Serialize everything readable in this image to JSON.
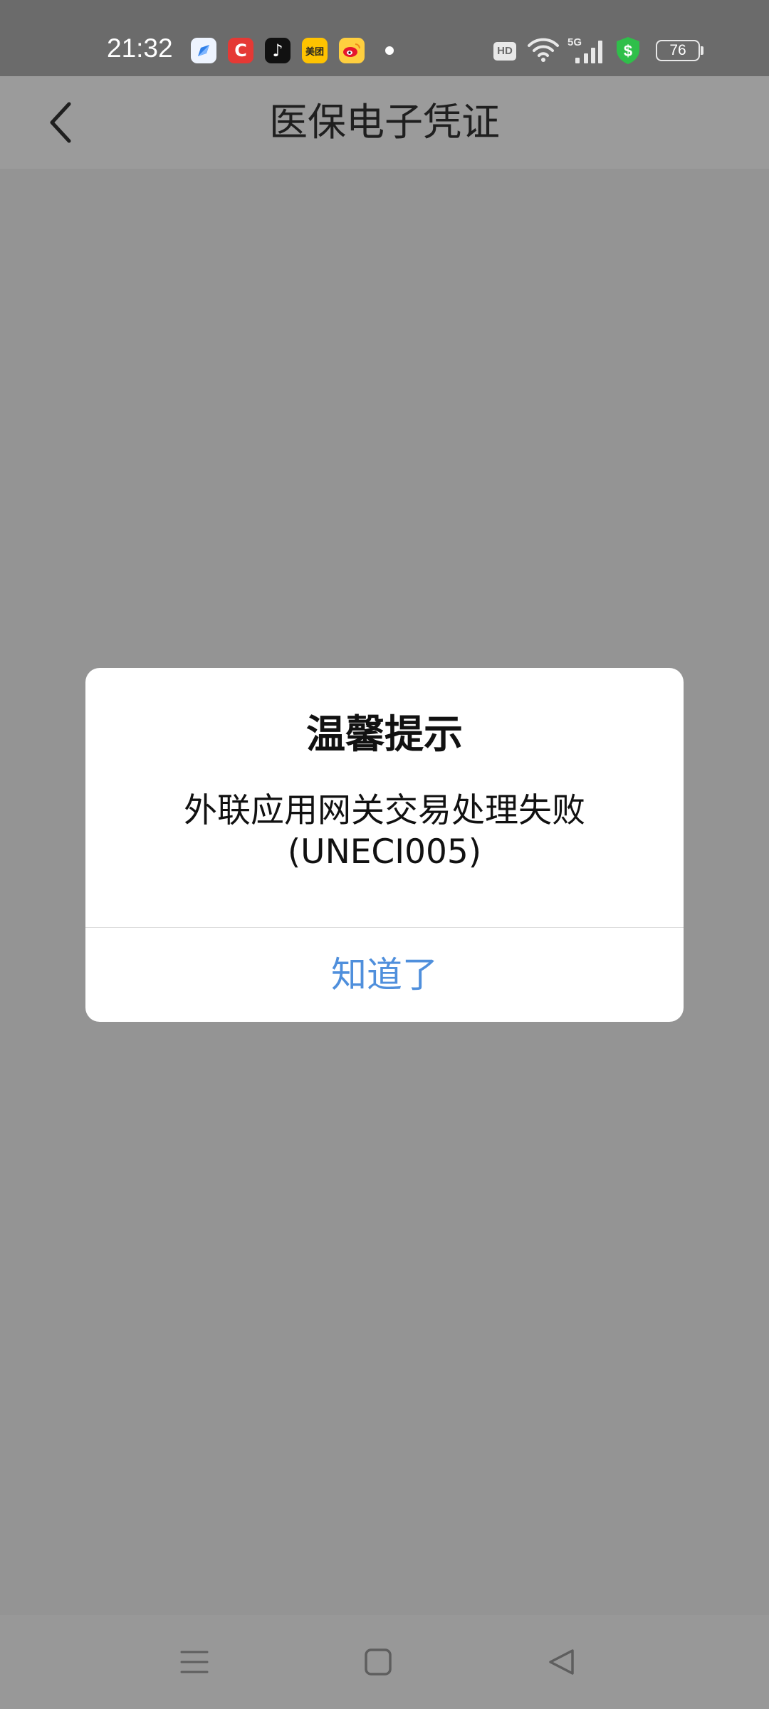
{
  "status_bar": {
    "time": "21:32",
    "notification_icons": [
      {
        "name": "browser-app-icon",
        "label": "",
        "bg": "#eef4ff",
        "fg": "#2f7fe8"
      },
      {
        "name": "red-c-app-icon",
        "label": "C",
        "bg": "#e53935",
        "fg": "#ffffff"
      },
      {
        "name": "tiktok-app-icon",
        "label": "♪",
        "bg": "#111111",
        "fg": "#ffffff"
      },
      {
        "name": "meituan-app-icon",
        "label": "美团",
        "bg": "#ffc300",
        "fg": "#222222"
      },
      {
        "name": "weibo-app-icon",
        "label": "",
        "bg": "#ffcf3f",
        "fg": "#e6162d"
      }
    ],
    "hd_label": "HD",
    "network_label": "5G",
    "battery_level": "76"
  },
  "header": {
    "title": "医保电子凭证"
  },
  "dialog": {
    "title": "温馨提示",
    "message": "外联应用网关交易处理失败\n(UNECI005)",
    "confirm_label": "知道了"
  },
  "colors": {
    "overlay": "#949494",
    "status_bar": "#6b6b6b",
    "accent": "#4f8fdc",
    "shield": "#2fbf4a"
  }
}
